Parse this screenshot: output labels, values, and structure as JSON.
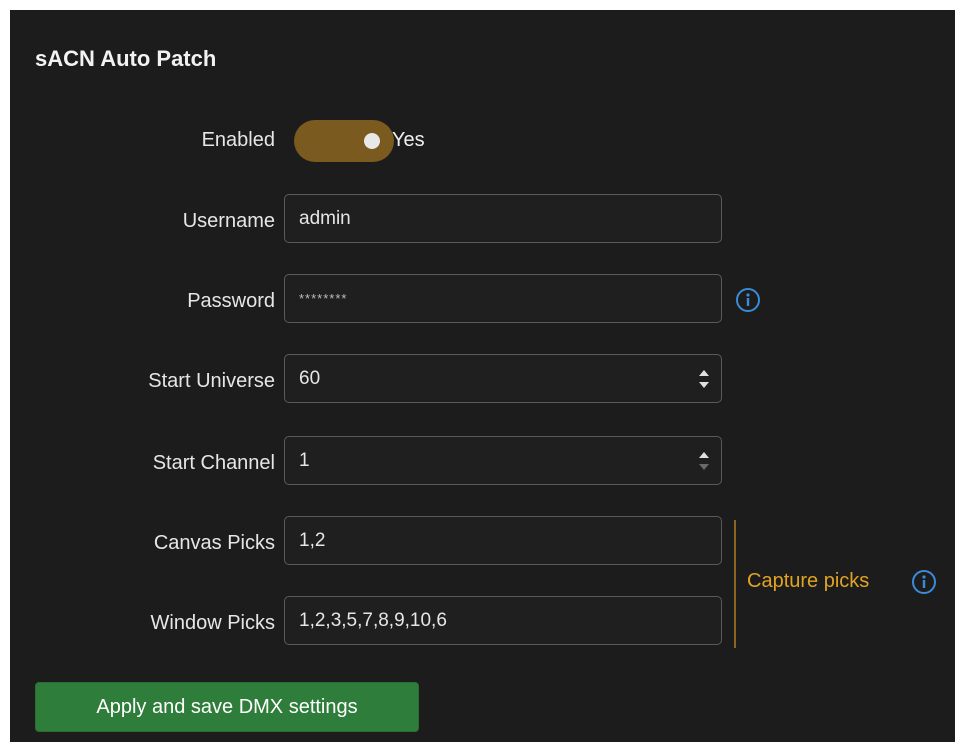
{
  "section": {
    "title": "sACN Auto Patch"
  },
  "enabled": {
    "label": "Enabled",
    "value_text": "Yes",
    "on": true
  },
  "username": {
    "label": "Username",
    "value": "admin"
  },
  "password": {
    "label": "Password",
    "value": "********"
  },
  "start_universe": {
    "label": "Start Universe",
    "value": "60"
  },
  "start_channel": {
    "label": "Start Channel",
    "value": "1"
  },
  "canvas_picks": {
    "label": "Canvas Picks",
    "value": "1,2"
  },
  "window_picks": {
    "label": "Window Picks",
    "value": "1,2,3,5,7,8,9,10,6"
  },
  "capture": {
    "label": "Capture picks"
  },
  "apply_button": {
    "label": "Apply and save DMX settings"
  },
  "colors": {
    "panel_bg": "#1c1c1c",
    "toggle_on": "#7a5a1e",
    "accent_orange": "#e2a322",
    "info_blue": "#3b8bd9",
    "button_green": "#2e7d3a"
  },
  "icons": {
    "password_info": "info-icon",
    "capture_info": "info-icon",
    "spinner": "chevron-up-down-icon"
  }
}
